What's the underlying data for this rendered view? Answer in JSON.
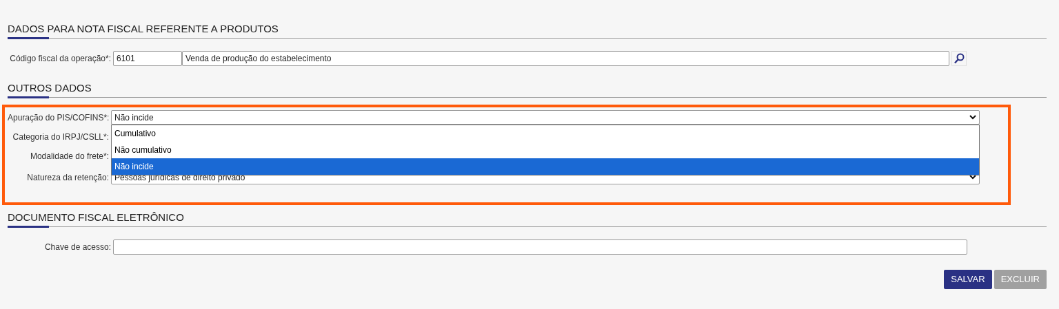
{
  "sections": [
    {
      "title": "DADOS PARA NOTA FISCAL REFERENTE A PRODUTOS",
      "highlighted": false,
      "rows": [
        {
          "kind": "code",
          "label": "Código fiscal da operação*:",
          "code": "6101",
          "description": "Venda de produção do estabelecimento"
        }
      ]
    },
    {
      "title": "OUTROS DADOS",
      "highlighted": true,
      "rows": [
        {
          "kind": "select",
          "label": "Apuração do PIS/COFINS*:",
          "value": "Não incide",
          "open": true,
          "options": [
            {
              "label": "Cumulativo",
              "selected": false
            },
            {
              "label": "Não cumulativo",
              "selected": false
            },
            {
              "label": "Não incide",
              "selected": true
            }
          ]
        },
        {
          "kind": "covered",
          "label": "Categoria do IRPJ/CSLL*:"
        },
        {
          "kind": "covered",
          "label": "Modalidade do frete*:"
        },
        {
          "kind": "select",
          "label": "Natureza da retenção:",
          "value": "Pessoas jurídicas de direito privado",
          "open": false
        }
      ]
    },
    {
      "title": "DOCUMENTO FISCAL ELETRÔNICO",
      "highlighted": false,
      "rows": [
        {
          "kind": "text",
          "label": "Chave de acesso:"
        }
      ]
    }
  ],
  "buttons": [
    {
      "label": "SALVAR",
      "disabled": false
    },
    {
      "label": "EXCLUIR",
      "disabled": true
    }
  ]
}
